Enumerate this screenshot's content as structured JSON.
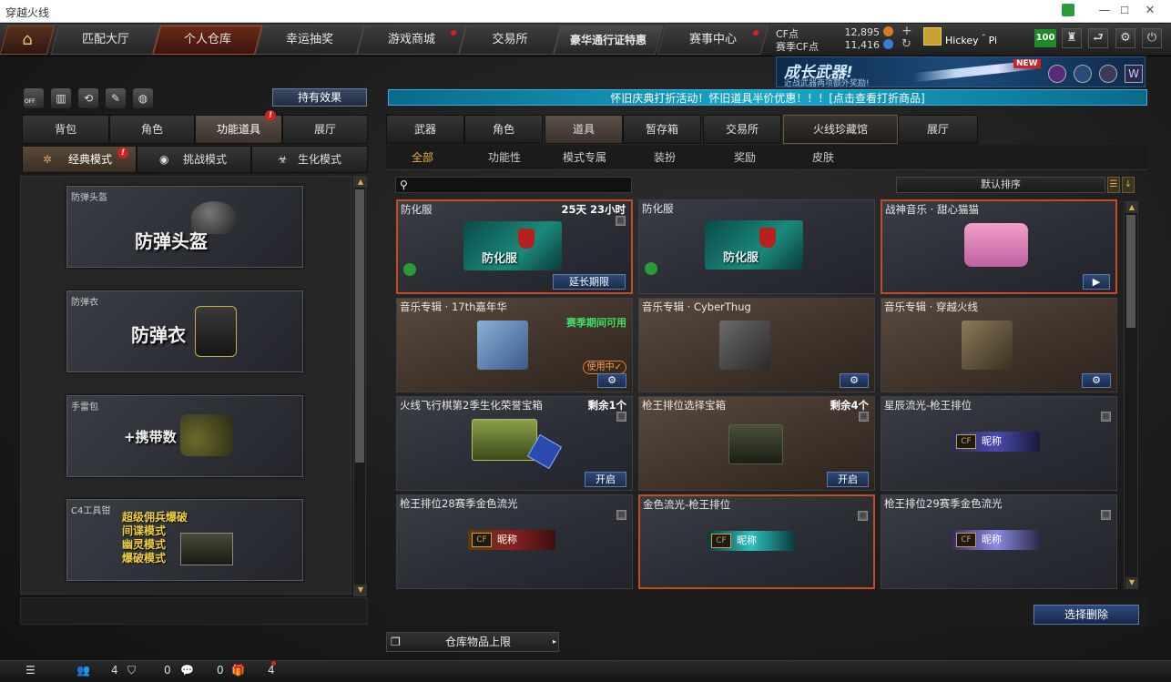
{
  "window": {
    "title": "穿越火线",
    "minimize": "—",
    "maximize": "☐",
    "close": "✕"
  },
  "nav": {
    "tabs": [
      {
        "label": "匹配大厅"
      },
      {
        "label": "个人仓库"
      },
      {
        "label": "幸运抽奖"
      },
      {
        "label": "游戏商城"
      },
      {
        "label": "交易所"
      },
      {
        "label": "豪华通行证特惠"
      },
      {
        "label": "赛事中心"
      }
    ],
    "cf_label": "CF点",
    "cf_value": "12,895",
    "season_cf_label": "赛季CF点",
    "season_cf_value": "11,416",
    "username": "Hickey＾Pi",
    "level": "100"
  },
  "promo": {
    "title": "成长武器!",
    "subtitle": "近战武器两项额外奖励!",
    "badge": "NEW"
  },
  "ticker": "怀旧庆典打折活动！怀旧道具半价优惠！！！[点击查看打折商品]",
  "left": {
    "off_label": "OFF",
    "effect_button": "持有效果",
    "tabs": [
      "背包",
      "角色",
      "功能道具",
      "展厅"
    ],
    "modes": [
      "经典模式",
      "挑战模式",
      "生化模式"
    ],
    "items": [
      {
        "caption": "防弹头盔",
        "label": "防弹头盔"
      },
      {
        "caption": "防弹衣",
        "label": "防弹衣"
      },
      {
        "caption": "手雷包",
        "label": "+携带数"
      },
      {
        "caption": "C4工具钳",
        "lines": [
          "超级佣兵爆破",
          "间谍模式",
          "幽灵模式",
          "爆破模式"
        ]
      }
    ]
  },
  "right": {
    "tabs": [
      "武器",
      "角色",
      "道具",
      "暂存箱",
      "交易所",
      "火线珍藏馆",
      "展厅"
    ],
    "subtabs": [
      "全部",
      "功能性",
      "模式专属",
      "装扮",
      "奖励",
      "皮肤"
    ],
    "search_placeholder": "",
    "sort_label": "默认排序",
    "cards": [
      {
        "name": "防化服",
        "right": "25天 23小时",
        "art": "防化服",
        "button": "延长期限"
      },
      {
        "name": "防化服",
        "right": "",
        "art": "防化服",
        "button": ""
      },
      {
        "name": "战神音乐 · 甜心猫猫",
        "right": "",
        "button": "▶"
      },
      {
        "name": "音乐专辑 · 17th嘉年华",
        "right": "",
        "status": "赛季期间可用",
        "tag": "使用中✓",
        "button": "⚙"
      },
      {
        "name": "音乐专辑 · CyberThug",
        "right": "",
        "button": "⚙"
      },
      {
        "name": "音乐专辑 · 穿越火线",
        "right": "",
        "button": "⚙"
      },
      {
        "name": "火线飞行棋第2季生化荣誉宝箱",
        "right": "剩余1个",
        "button": "开启"
      },
      {
        "name": "枪王排位选择宝箱",
        "right": "剩余4个",
        "button": "开启"
      },
      {
        "name": "星辰流光-枪王排位",
        "right": "",
        "plate": "昵称"
      },
      {
        "name": "枪王排位28赛季金色流光",
        "right": "",
        "plate": "昵称"
      },
      {
        "name": "金色流光-枪王排位",
        "right": "",
        "plate": "昵称"
      },
      {
        "name": "枪王排位29赛季金色流光",
        "right": "",
        "plate": "昵称"
      }
    ],
    "delete_button": "选择删除",
    "capacity_label": "仓库物品上限"
  },
  "status": {
    "friends": "4",
    "guard": "0",
    "chat": "0",
    "gifts": "4"
  }
}
